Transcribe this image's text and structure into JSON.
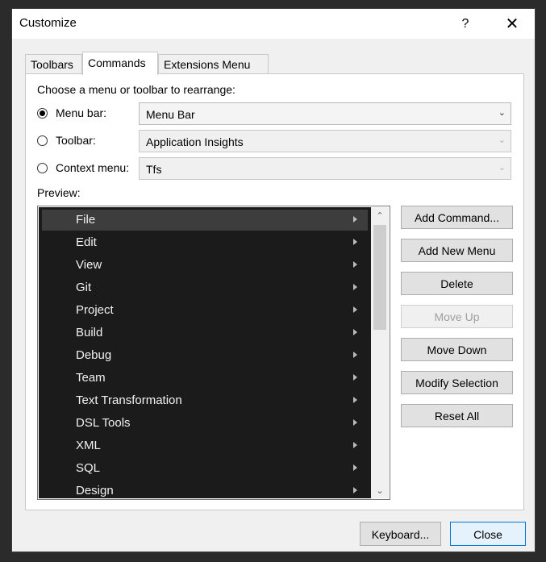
{
  "window": {
    "title": "Customize",
    "help_symbol": "?",
    "close_symbol": "✕"
  },
  "tabs": [
    {
      "label": "Toolbars",
      "active": false
    },
    {
      "label": "Commands",
      "active": true
    },
    {
      "label": "Extensions Menu",
      "active": false
    }
  ],
  "choose_label": "Choose a menu or toolbar to rearrange:",
  "options": [
    {
      "label": "Menu bar:",
      "checked": true,
      "value": "Menu Bar",
      "enabled": true
    },
    {
      "label": "Toolbar:",
      "checked": false,
      "value": "Application Insights",
      "enabled": false
    },
    {
      "label": "Context menu:",
      "checked": false,
      "value": "Tfs",
      "enabled": false
    }
  ],
  "preview_label": "Preview:",
  "menu_items": [
    "File",
    "Edit",
    "View",
    "Git",
    "Project",
    "Build",
    "Debug",
    "Team",
    "Text Transformation",
    "DSL Tools",
    "XML",
    "SQL",
    "Design"
  ],
  "selected_menu_item": "File",
  "buttons": {
    "add_command": "Add Command...",
    "add_new_menu": "Add New Menu",
    "delete": "Delete",
    "move_up": "Move Up",
    "move_down": "Move Down",
    "modify_selection": "Modify Selection",
    "reset_all": "Reset All",
    "keyboard": "Keyboard...",
    "close": "Close"
  },
  "icons": {
    "scroll_up": "chevron-up-icon",
    "scroll_down": "chevron-down-icon",
    "submenu": "submenu-arrow-icon"
  }
}
